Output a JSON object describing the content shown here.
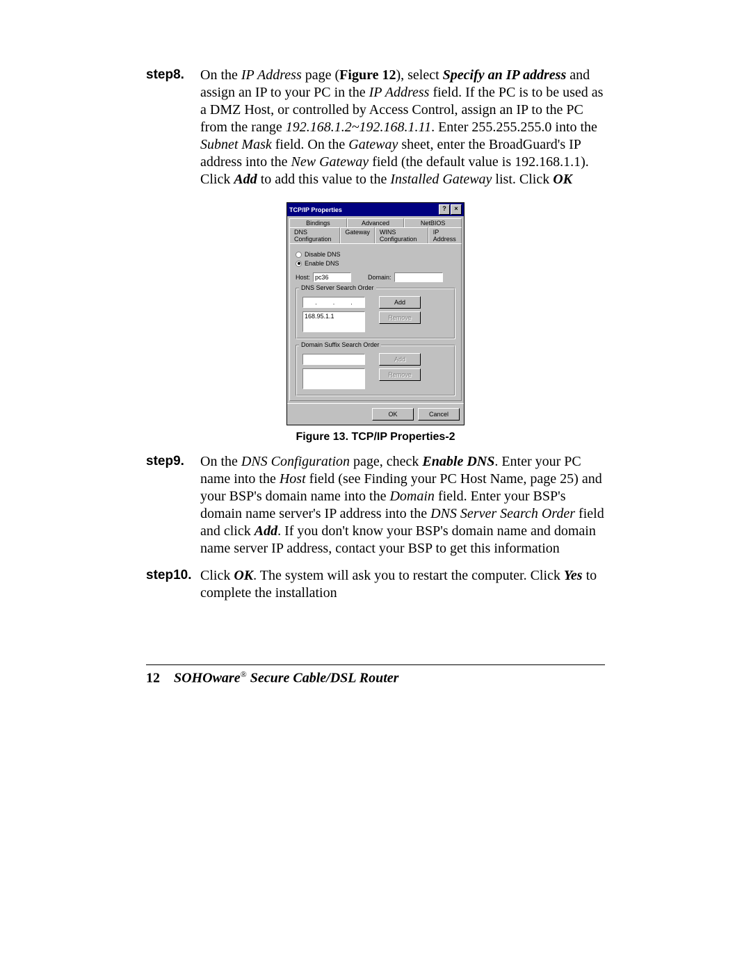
{
  "steps": {
    "s8": {
      "label": "step8.",
      "t1": "On the ",
      "ip_page": "IP Address",
      "t2": " page (",
      "fig12": "Figure 12",
      "t3": "), select ",
      "specify": "Specify an IP address",
      "t4": " and assign an IP to your PC in the ",
      "ip_field": "IP Address",
      "t5": " field.  If the PC is to be used as a DMZ Host, or controlled by Access Control, assign an IP to the PC from the range ",
      "range": "192.168.1.2~192.168.1.11",
      "t6": ".  Enter 255.255.255.0 into the ",
      "subnet": "Subnet Mask",
      "t7": " field.  On the ",
      "gateway": "Gateway",
      "t8": " sheet, enter the BroadGuard's IP address into the ",
      "newgw": "New Gateway",
      "t9": " field (the default value is 192.168.1.1). Click ",
      "add": "Add",
      "t10": " to add this value to the ",
      "installed": "Installed Gateway",
      "t11": " list.  Click ",
      "ok": "OK"
    },
    "s9": {
      "label": "step9.",
      "t1": "On the ",
      "dns_page": "DNS Configuration",
      "t2": " page, check ",
      "enable": "Enable DNS",
      "t3": ".  Enter your PC name into the ",
      "host": "Host",
      "t4": " field (see Finding your PC Host Name, page 25) and your BSP's domain name into the ",
      "domain": "Domain",
      "t5": " field.  Enter your BSP's domain name server's IP address into the ",
      "dnso": "DNS Server Search Order",
      "t6": " field and click ",
      "add": "Add",
      "t7": ".  If you don't know your BSP's domain name and domain name server IP address, contact your BSP to get this information"
    },
    "s10": {
      "label": "step10.",
      "t1": "Click ",
      "ok": "OK",
      "t2": ".  The system will ask you to restart the computer.  Click ",
      "yes": "Yes",
      "t3": " to complete the installation"
    }
  },
  "dialog": {
    "title": "TCP/IP Properties",
    "help_btn": "?",
    "close_btn": "×",
    "tabs_row1": {
      "bindings": "Bindings",
      "advanced": "Advanced",
      "netbios": "NetBIOS"
    },
    "tabs_row2": {
      "dnsconf": "DNS Configuration",
      "gateway": "Gateway",
      "winsconf": "WINS Configuration",
      "ipaddr": "IP Address"
    },
    "radio_disable": "Disable DNS",
    "radio_enable": "Enable DNS",
    "host_label": "Host:",
    "host_value": "pc36",
    "domain_label": "Domain:",
    "group1_label": "DNS Server Search Order",
    "ip_dot": ".",
    "add_btn": "Add",
    "remove_btn": "Remove",
    "dns_entry": "168.95.1.1",
    "group2_label": "Domain Suffix Search Order",
    "add2_btn": "Add",
    "remove2_btn": "Remove",
    "ok_btn": "OK",
    "cancel_btn": "Cancel"
  },
  "figure_caption": "Figure 13. TCP/IP Properties-2",
  "footer": {
    "page_number": "12",
    "brand": "SOHOware",
    "reg": "®",
    "product": " Secure Cable/DSL Router"
  }
}
